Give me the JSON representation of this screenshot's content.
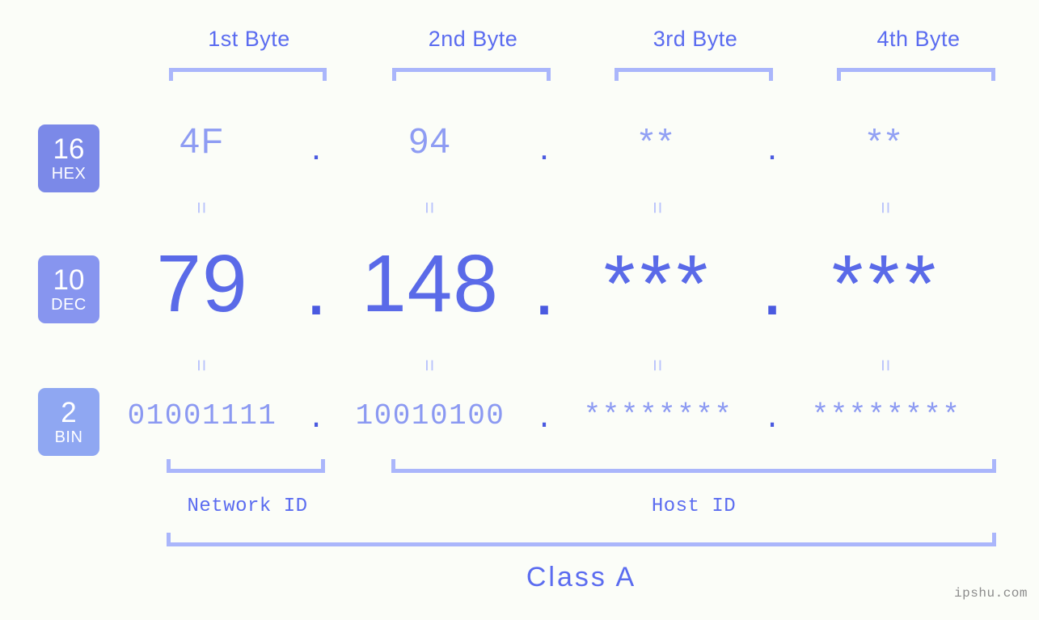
{
  "meta": {
    "background": "#fbfdf8",
    "accent": "#5b6cf0",
    "bracket_color": "#aab6fb",
    "watermark": "ipshu.com"
  },
  "headers": [
    {
      "label": "1st Byte"
    },
    {
      "label": "2nd Byte"
    },
    {
      "label": "3rd Byte"
    },
    {
      "label": "4th Byte"
    }
  ],
  "bases": [
    {
      "number": "16",
      "name": "HEX",
      "color": "#7b89e8"
    },
    {
      "number": "10",
      "name": "DEC",
      "color": "#8795ef"
    },
    {
      "number": "2",
      "name": "BIN",
      "color": "#8fa7f2"
    }
  ],
  "separator": ".",
  "equals": "=",
  "rows": {
    "hex": {
      "base_label": "HEX",
      "values": [
        "4F",
        "94",
        "**",
        "**"
      ],
      "masked": [
        false,
        false,
        true,
        true
      ]
    },
    "dec": {
      "base_label": "DEC",
      "values": [
        "79",
        "148",
        "***",
        "***"
      ],
      "masked": [
        false,
        false,
        true,
        true
      ]
    },
    "bin": {
      "base_label": "BIN",
      "values": [
        "01001111",
        "10010100",
        "********",
        "********"
      ],
      "masked": [
        false,
        false,
        true,
        true
      ]
    }
  },
  "segments": {
    "network_id": "Network ID",
    "host_id": "Host ID"
  },
  "class": {
    "label": "Class A"
  },
  "ip_summary": {
    "hex": "4F.94.**.**",
    "dec": "79.148.***.***",
    "bin": "01001111.10010100.********.********"
  }
}
